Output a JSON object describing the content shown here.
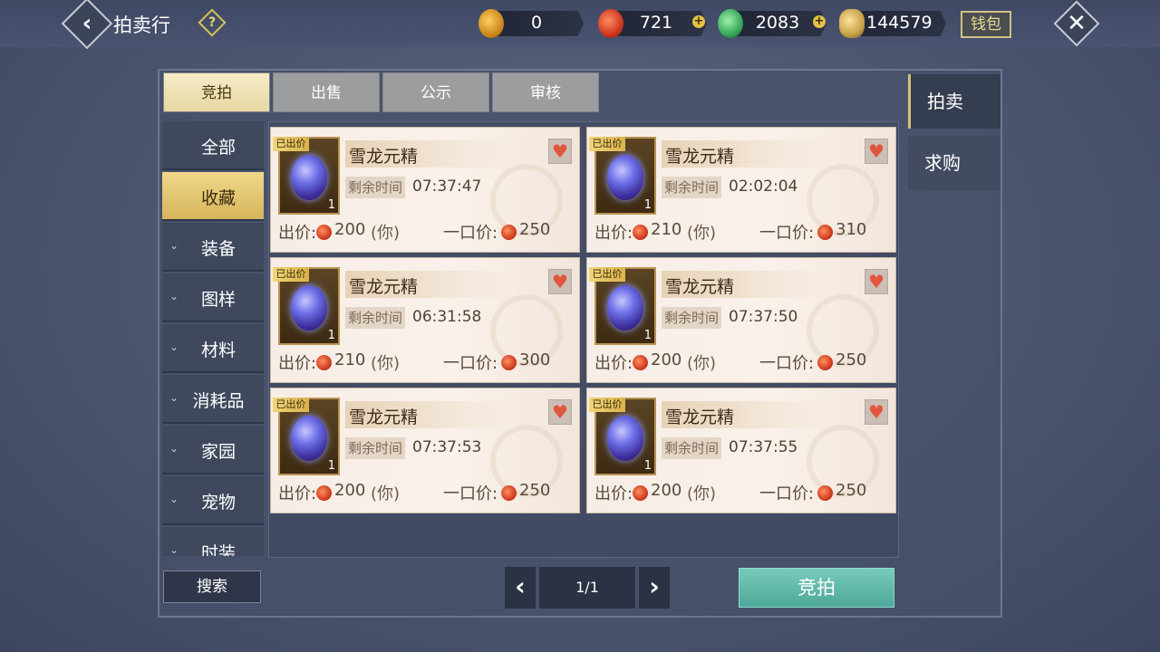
{
  "header": {
    "title": "拍卖行",
    "help_icon": "question-icon",
    "currencies": [
      {
        "name": "gold-token",
        "value": "0",
        "color": "#e0a030"
      },
      {
        "name": "red-coin",
        "value": "721",
        "color": "#d2452a"
      },
      {
        "name": "jade-coin",
        "value": "2083",
        "color": "#3cb86a"
      },
      {
        "name": "gold-ingot",
        "value": "144579",
        "color": "#c9a24a"
      }
    ],
    "wallet_label": "钱包"
  },
  "tabs": [
    {
      "label": "竞拍",
      "active": true
    },
    {
      "label": "出售",
      "active": false
    },
    {
      "label": "公示",
      "active": false
    },
    {
      "label": "审核",
      "active": false
    }
  ],
  "categories": [
    {
      "label": "全部",
      "active": false,
      "has_arrow": false
    },
    {
      "label": "收藏",
      "active": true,
      "has_arrow": false
    },
    {
      "label": "装备",
      "active": false,
      "has_arrow": true
    },
    {
      "label": "图样",
      "active": false,
      "has_arrow": true
    },
    {
      "label": "材料",
      "active": false,
      "has_arrow": true
    },
    {
      "label": "消耗品",
      "active": false,
      "has_arrow": true
    },
    {
      "label": "家园",
      "active": false,
      "has_arrow": true
    },
    {
      "label": "宠物",
      "active": false,
      "has_arrow": true
    },
    {
      "label": "时装",
      "active": false,
      "has_arrow": true
    }
  ],
  "items": [
    {
      "bid_tag": "已出价",
      "name": "雪龙元精",
      "qty": "1",
      "time_label": "剩余时间",
      "time": "07:37:47",
      "bid_label": "出价:",
      "bid": "200",
      "you": "(你)",
      "buyout_label": "一口价:",
      "buyout": "250"
    },
    {
      "bid_tag": "已出价",
      "name": "雪龙元精",
      "qty": "1",
      "time_label": "剩余时间",
      "time": "02:02:04",
      "bid_label": "出价:",
      "bid": "210",
      "you": "(你)",
      "buyout_label": "一口价:",
      "buyout": "310"
    },
    {
      "bid_tag": "已出价",
      "name": "雪龙元精",
      "qty": "1",
      "time_label": "剩余时间",
      "time": "06:31:58",
      "bid_label": "出价:",
      "bid": "210",
      "you": "(你)",
      "buyout_label": "一口价:",
      "buyout": "300"
    },
    {
      "bid_tag": "已出价",
      "name": "雪龙元精",
      "qty": "1",
      "time_label": "剩余时间",
      "time": "07:37:50",
      "bid_label": "出价:",
      "bid": "200",
      "you": "(你)",
      "buyout_label": "一口价:",
      "buyout": "250"
    },
    {
      "bid_tag": "已出价",
      "name": "雪龙元精",
      "qty": "1",
      "time_label": "剩余时间",
      "time": "07:37:53",
      "bid_label": "出价:",
      "bid": "200",
      "you": "(你)",
      "buyout_label": "一口价:",
      "buyout": "250"
    },
    {
      "bid_tag": "已出价",
      "name": "雪龙元精",
      "qty": "1",
      "time_label": "剩余时间",
      "time": "07:37:55",
      "bid_label": "出价:",
      "bid": "200",
      "you": "(你)",
      "buyout_label": "一口价:",
      "buyout": "250"
    }
  ],
  "right_tabs": [
    {
      "label": "拍卖",
      "active": true
    },
    {
      "label": "求购",
      "active": false
    }
  ],
  "footer": {
    "search_label": "搜索",
    "page": "1/1",
    "bid_button": "竞拍"
  }
}
